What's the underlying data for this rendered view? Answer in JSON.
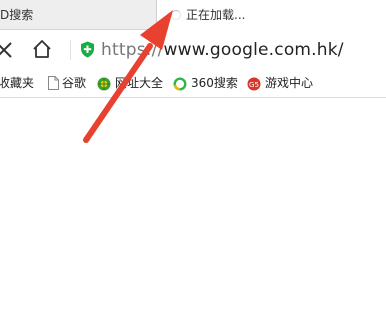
{
  "tabs": [
    {
      "label": "D搜索",
      "active": false
    },
    {
      "label": "正在加载...",
      "active": true
    }
  ],
  "toolbar": {
    "close_icon": "close-icon",
    "home_icon": "home-icon",
    "security_icon": "shield-icon",
    "url_scheme": "https://",
    "url_rest": "www.google.com.hk/"
  },
  "bookmarks": [
    {
      "label": "收藏夹",
      "icon": "none"
    },
    {
      "label": "谷歌",
      "icon": "page-icon"
    },
    {
      "label": "网址大全",
      "icon": "hao-icon"
    },
    {
      "label": "360搜索",
      "icon": "search360-icon"
    },
    {
      "label": "游戏中心",
      "icon": "game-icon"
    }
  ],
  "colors": {
    "shield": "#1aad45",
    "arrow": "#e8412f"
  }
}
